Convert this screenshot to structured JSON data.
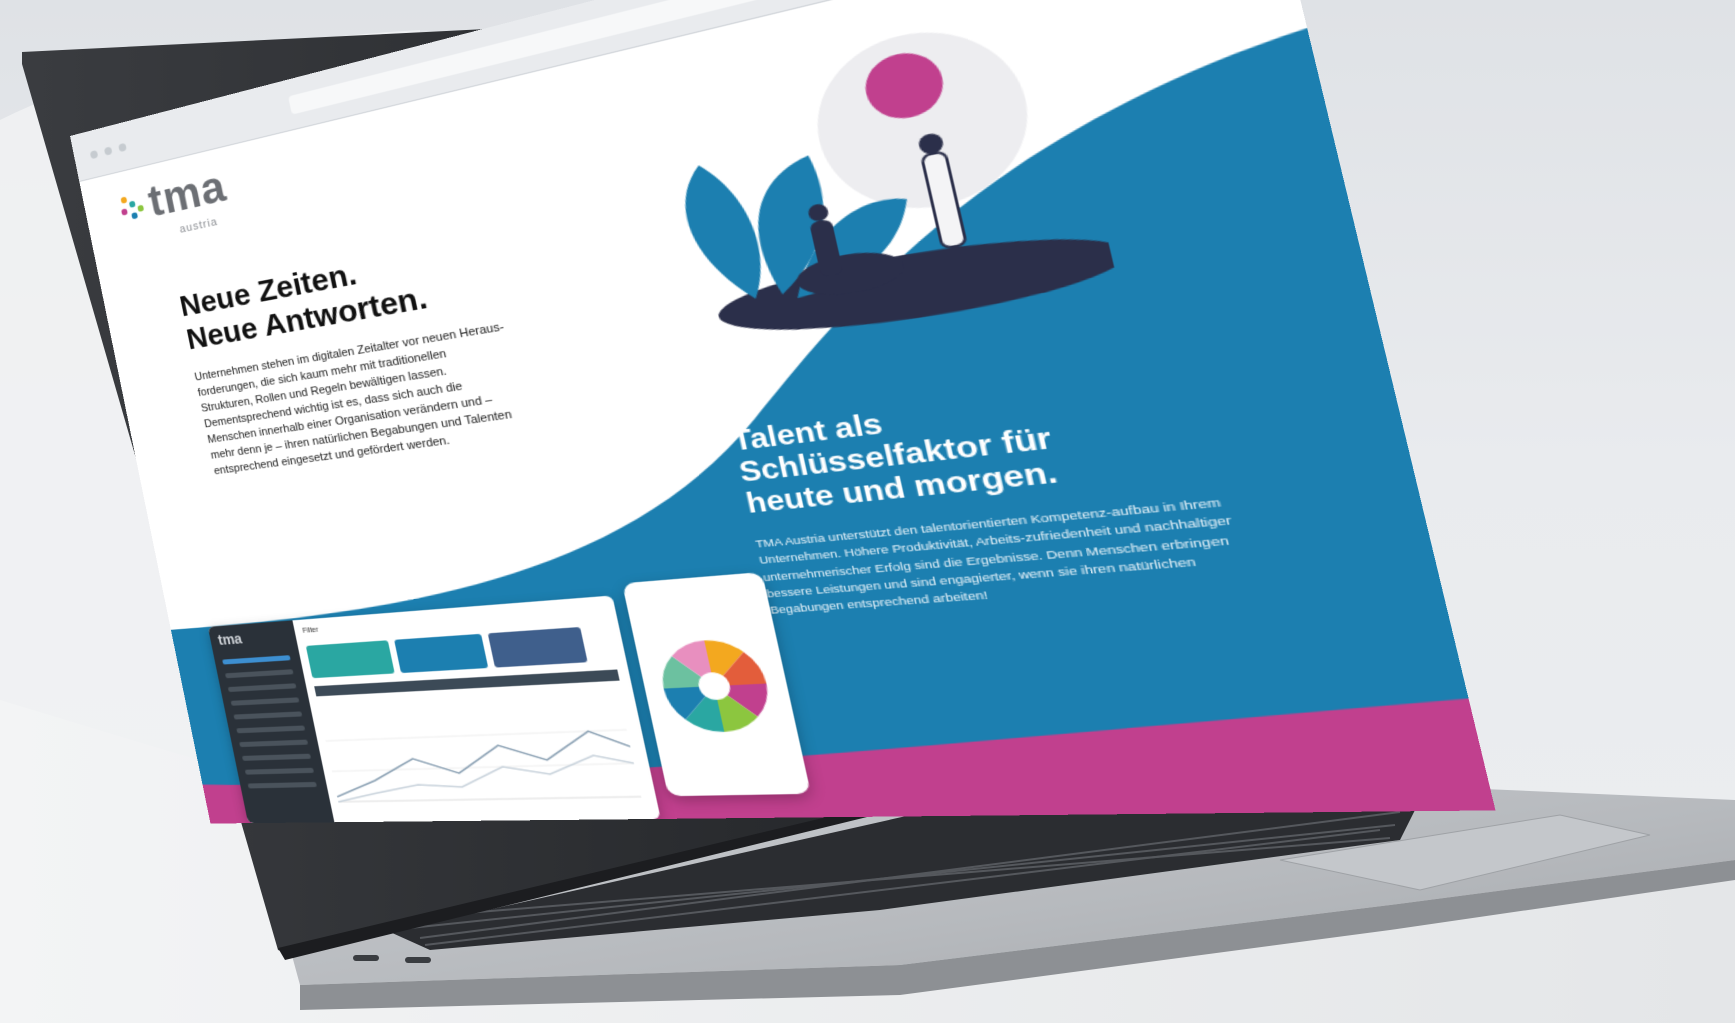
{
  "browser": {
    "url": "",
    "extra": ""
  },
  "logo": {
    "word": "tma",
    "sub": "austria"
  },
  "hero": {
    "line1": "Neue Zeiten.",
    "line2": "Neue Antworten.",
    "intro": "Unternehmen stehen im digitalen Zeitalter vor neuen Heraus-forderungen, die sich kaum mehr mit traditionellen Strukturen, Rollen und Regeln bewältigen lassen. Dementsprechend wichtig ist es, dass sich auch die Menschen innerhalb einer Organisation verändern und – mehr denn je – ihren natürlichen Begabungen und Talenten entsprechend eingesetzt und gefördert werden."
  },
  "talent": {
    "line1": "Talent als",
    "line2": "Schlüsselfaktor für",
    "line3": "heute und morgen.",
    "text": "TMA Austria unterstützt den talentorientierten Kompetenz-aufbau in Ihrem Unternehmen. Höhere Produktivität, Arbeits-zufriedenheit und nachhaltiger unternehmerischer Erfolg sind die Ergebnisse. Denn Menschen erbringen bessere Leistungen und sind engagierter, wenn sie ihren natürlichen Begabungen entsprechend arbeiten!"
  },
  "mockup": {
    "logo": "tma",
    "filter_label": "Filter"
  },
  "colors": {
    "blue": "#1c7fb0",
    "magenta": "#c1408e",
    "navy": "#2b2f4a",
    "laptop_silver": "#b9bcc0"
  }
}
